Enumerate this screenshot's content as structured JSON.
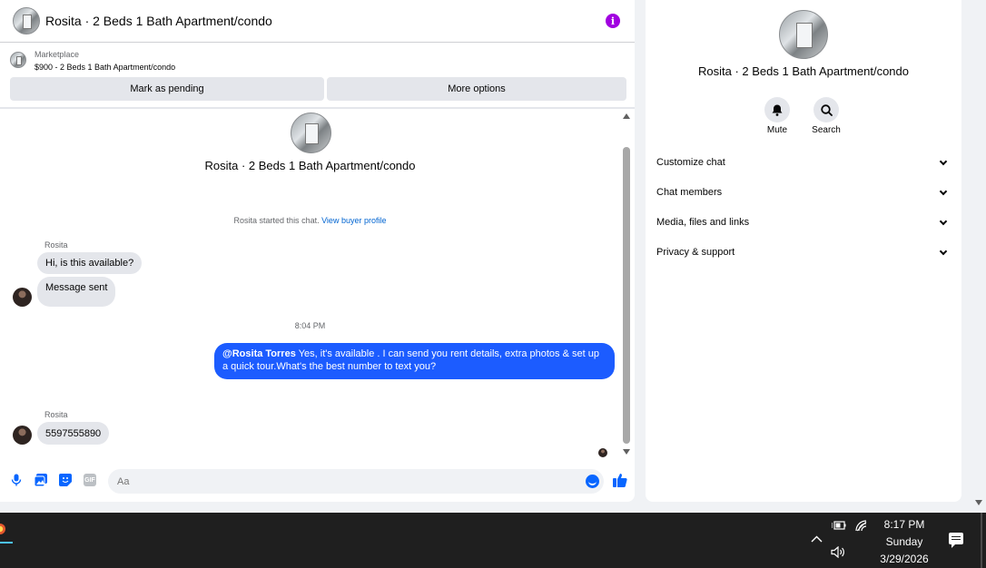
{
  "chat": {
    "title": "Rosita · 2 Beds 1 Bath Apartment/condo",
    "info_icon": "info-icon",
    "marketplace": {
      "label": "Marketplace",
      "item": "$900 - 2 Beds 1 Bath Apartment/condo",
      "pending_label": "Mark as pending",
      "more_label": "More options"
    },
    "thread": {
      "name": "Rosita · 2 Beds 1 Bath Apartment/condo",
      "started_text": "Rosita started this chat.",
      "buyer_link": "View buyer profile",
      "sender1": "Rosita",
      "msg1": "Hi, is this available?",
      "msg2": "Message sent",
      "timestamp": "8:04 PM",
      "out_mention": "@Rosita Torres",
      "out_text": "Yes, it's available .  I can send you rent details, extra photos & set up a quick tour.What's the best number to text you?",
      "sender2": "Rosita",
      "msg3": "5597555890"
    },
    "composer": {
      "placeholder": "Aa",
      "gif_label": "GIF"
    }
  },
  "details": {
    "name": "Rosita · 2 Beds 1 Bath Apartment/condo",
    "mute_label": "Mute",
    "search_label": "Search",
    "sections": [
      "Customize chat",
      "Chat members",
      "Media, files and links",
      "Privacy & support"
    ]
  },
  "taskbar": {
    "time": "8:17 PM",
    "day": "Sunday",
    "date": "3/29/2026"
  },
  "colors": {
    "accent": "#0866ff",
    "outgoing_bubble": "#1c5cff",
    "info": "#a100e0",
    "taskbar": "#1f1f1f"
  }
}
